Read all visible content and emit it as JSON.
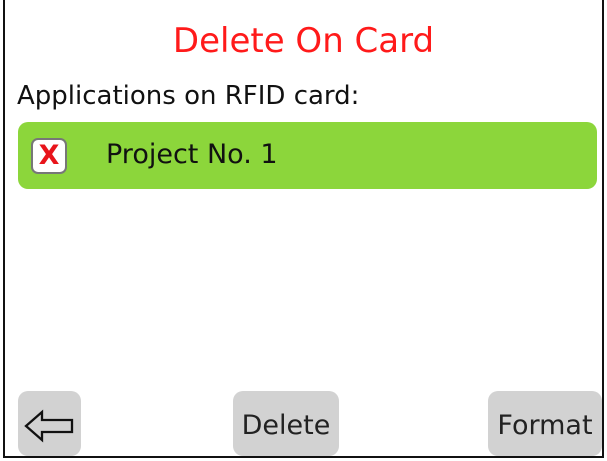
{
  "screen": {
    "title": "Delete On Card",
    "section_label": "Applications on RFID card:"
  },
  "applications": [
    {
      "name": "Project No. 1",
      "selected": true,
      "mark": "X"
    }
  ],
  "buttons": {
    "back_icon": "left-arrow-icon",
    "delete_label": "Delete",
    "format_label": "Format"
  },
  "colors": {
    "title": "#ff1a1a",
    "selected_row": "#8cd63b",
    "button": "#d2d2d2",
    "checkbox_mark": "#e8141b"
  }
}
